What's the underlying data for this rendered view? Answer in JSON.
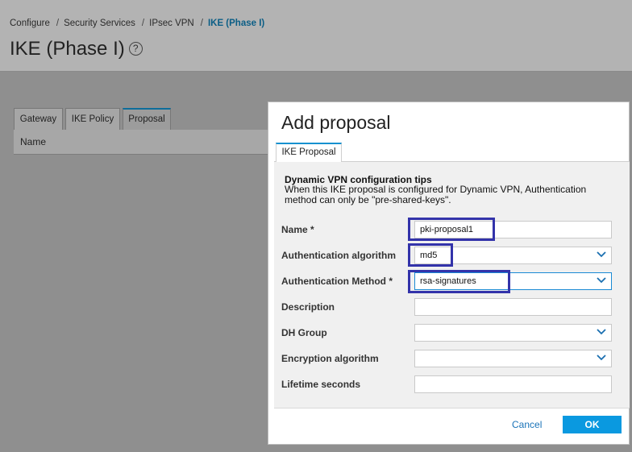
{
  "breadcrumb": {
    "items": [
      "Configure",
      "Security Services",
      "IPsec VPN"
    ],
    "current": "IKE (Phase I)"
  },
  "page": {
    "title": "IKE (Phase I)",
    "help_icon": "question-circle-icon"
  },
  "background_tabs": [
    {
      "label": "Gateway",
      "active": false
    },
    {
      "label": "IKE Policy",
      "active": false
    },
    {
      "label": "Proposal",
      "active": true
    }
  ],
  "background_table": {
    "columns": [
      "Name"
    ]
  },
  "modal": {
    "title": "Add proposal",
    "tab": "IKE Proposal",
    "tips": {
      "title": "Dynamic VPN configuration tips",
      "text": "When this IKE proposal is configured for Dynamic VPN, Authentication method can only be \"pre-shared-keys\"."
    },
    "fields": {
      "name": {
        "label": "Name *",
        "value": "pki-proposal1"
      },
      "auth_algorithm": {
        "label": "Authentication algorithm",
        "value": "md5"
      },
      "auth_method": {
        "label": "Authentication Method *",
        "value": "rsa-signatures"
      },
      "description": {
        "label": "Description",
        "value": ""
      },
      "dh_group": {
        "label": "DH Group",
        "value": ""
      },
      "encryption_algorithm": {
        "label": "Encryption algorithm",
        "value": ""
      },
      "lifetime_seconds": {
        "label": "Lifetime seconds",
        "value": ""
      }
    },
    "buttons": {
      "cancel": "Cancel",
      "ok": "OK"
    }
  },
  "colors": {
    "accent": "#0a99e0",
    "highlight": "#3333aa",
    "link": "#1a73b8"
  }
}
